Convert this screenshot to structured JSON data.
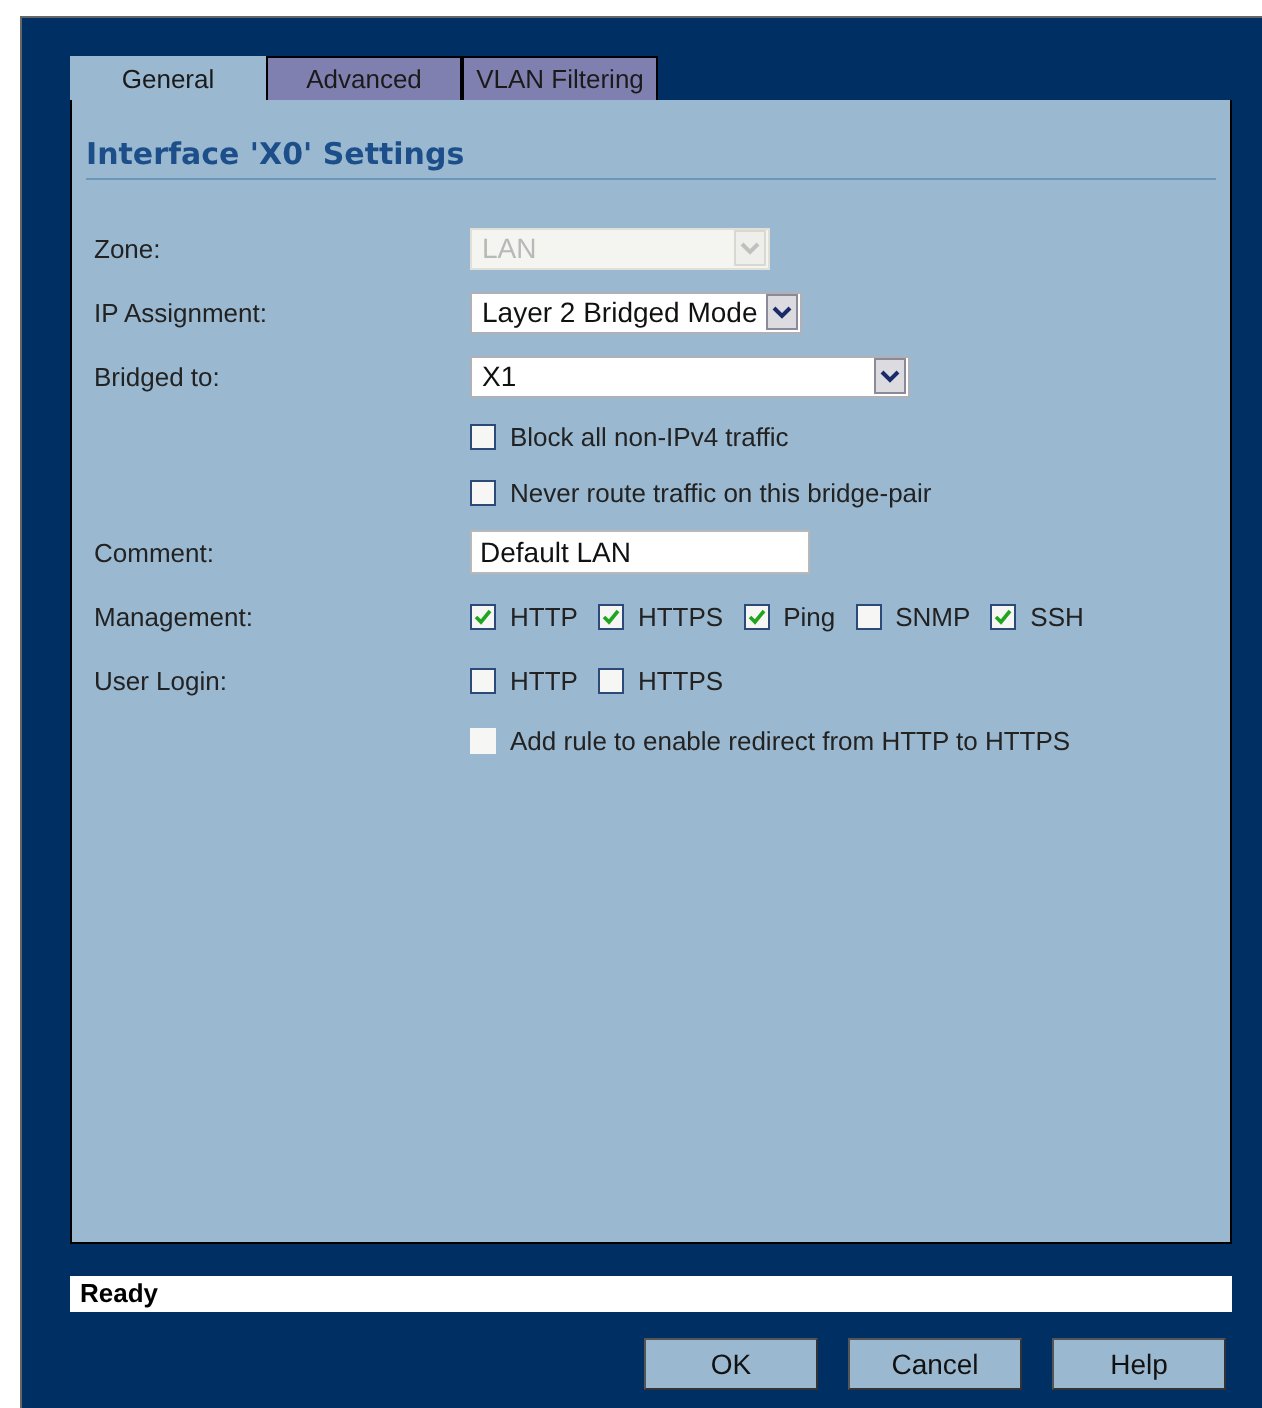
{
  "tabs": [
    {
      "label": "General",
      "selected": true
    },
    {
      "label": "Advanced",
      "selected": false
    },
    {
      "label": "VLAN Filtering",
      "selected": false
    }
  ],
  "heading": "Interface 'X0' Settings",
  "rows": [
    {
      "kind": "select",
      "label": "Zone:",
      "value": "LAN",
      "disabled": true,
      "wide": false
    },
    {
      "kind": "select",
      "label": "IP Assignment:",
      "value": "Layer 2 Bridged Mode",
      "disabled": false,
      "wide": false
    },
    {
      "kind": "select",
      "label": "Bridged to:",
      "value": "X1",
      "disabled": false,
      "wide": true
    },
    {
      "kind": "checks",
      "options": [
        {
          "label": "Block all non-IPv4 traffic",
          "checked": false,
          "disabled": false
        }
      ]
    },
    {
      "kind": "checks",
      "options": [
        {
          "label": "Never route traffic on this bridge-pair",
          "checked": false,
          "disabled": false
        }
      ]
    },
    {
      "kind": "text",
      "label": "Comment:",
      "value": "Default LAN"
    },
    {
      "kind": "checks",
      "label": "Management:",
      "options": [
        {
          "label": "HTTP",
          "checked": true,
          "disabled": false
        },
        {
          "label": "HTTPS",
          "checked": true,
          "disabled": false
        },
        {
          "label": "Ping",
          "checked": true,
          "disabled": false
        },
        {
          "label": "SNMP",
          "checked": false,
          "disabled": false
        },
        {
          "label": "SSH",
          "checked": true,
          "disabled": false
        }
      ]
    },
    {
      "kind": "checks",
      "label": "User Login:",
      "options": [
        {
          "label": "HTTP",
          "checked": false,
          "disabled": false
        },
        {
          "label": "HTTPS",
          "checked": false,
          "disabled": false
        }
      ]
    },
    {
      "kind": "checks",
      "options": [
        {
          "label": "Add rule to enable redirect from HTTP to HTTPS",
          "checked": false,
          "disabled": true
        }
      ]
    }
  ],
  "status_bar": "Ready",
  "buttons": [
    "OK",
    "Cancel",
    "Help"
  ]
}
